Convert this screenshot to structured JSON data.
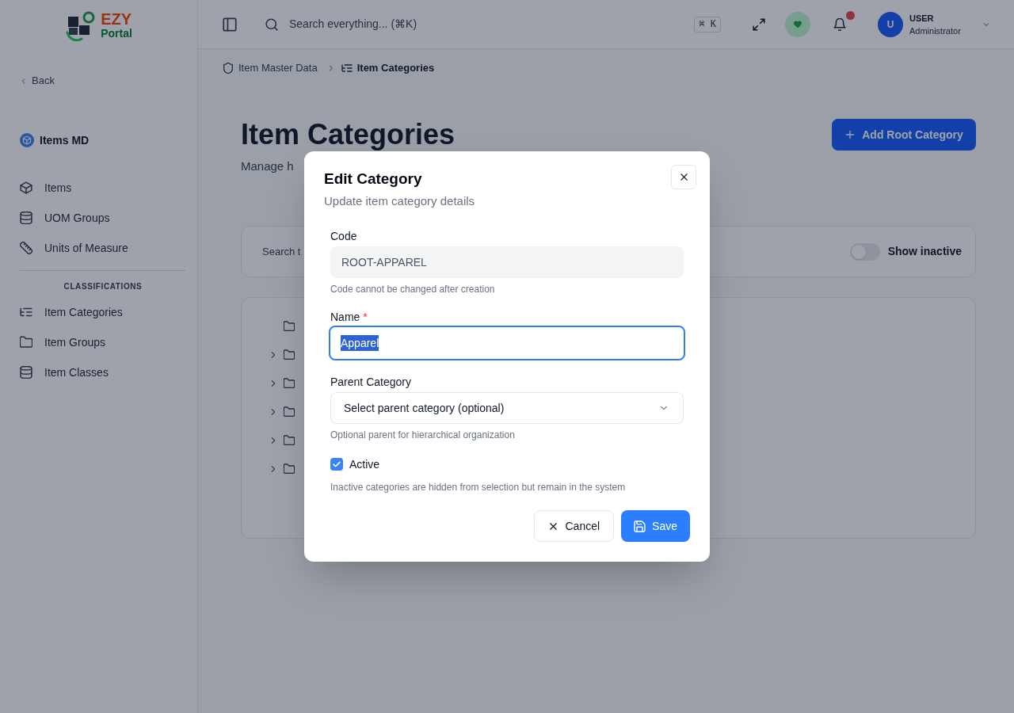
{
  "sidebar": {
    "logo": {
      "word": "EZY",
      "subword": "Portal"
    },
    "back_link": "Back",
    "module": "Items MD",
    "sections": [
      {
        "items": [
          {
            "label": "Items",
            "selected": false
          },
          {
            "label": "UOM Groups",
            "selected": false
          },
          {
            "label": "Units of Measure",
            "selected": false
          }
        ]
      },
      {
        "heading": "CLASSIFICATIONS",
        "items": [
          {
            "label": "Item Categories",
            "selected": false
          },
          {
            "label": "Item Groups",
            "selected": false
          },
          {
            "label": "Item Classes",
            "selected": false
          }
        ]
      }
    ]
  },
  "header": {
    "search": {
      "placeholder": "Search everything... (⌘K)",
      "shortcut": "⌘ K"
    },
    "notifications": {
      "unread": true
    },
    "user": {
      "initial": "U",
      "name": "USER",
      "role": "Administrator"
    }
  },
  "breadcrumb": [
    {
      "label": "Item Master Data",
      "current": false
    },
    {
      "label": "Item Categories",
      "current": true
    }
  ],
  "page": {
    "title": "Item Categories",
    "subtitle": "Manage h",
    "add_button": "Add Root Category"
  },
  "filters": {
    "search_placeholder": "Search t",
    "show_inactive": {
      "label": "Show inactive",
      "on": false
    }
  },
  "tree": {
    "nodes": [
      {
        "has_children": false
      },
      {
        "has_children": true
      },
      {
        "has_children": true
      },
      {
        "has_children": true
      },
      {
        "has_children": true
      },
      {
        "has_children": true
      }
    ]
  },
  "dialog": {
    "title": "Edit Category",
    "subtitle": "Update item category details",
    "fields": [
      {
        "kind": "text",
        "label": "Code",
        "value": "ROOT-APPAREL",
        "disabled": true,
        "focused": false,
        "text_selected": false,
        "help": "Code cannot be changed after creation"
      },
      {
        "kind": "text",
        "label": "Name",
        "required_mark": "*",
        "value": "Apparel",
        "disabled": false,
        "focused": true,
        "text_selected": true
      },
      {
        "kind": "select",
        "label": "Parent Category",
        "value": "Select parent category (optional)",
        "help": "Optional parent for hierarchical organization"
      },
      {
        "kind": "checkbox",
        "label": "Active",
        "checked": true,
        "help": "Inactive categories are hidden from selection but remain in the system"
      }
    ],
    "buttons": [
      {
        "label": "Cancel",
        "kind": "secondary"
      },
      {
        "label": "Save",
        "kind": "primary"
      }
    ]
  }
}
